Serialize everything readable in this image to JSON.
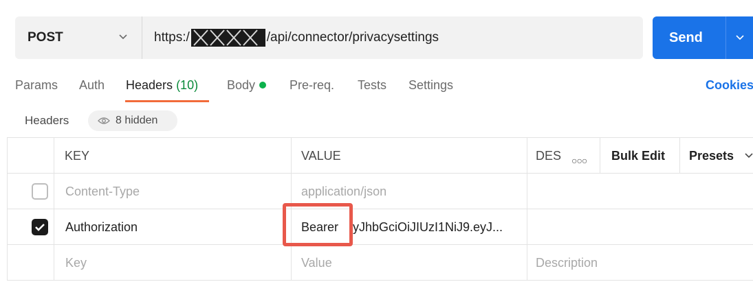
{
  "request": {
    "method": "POST",
    "url_prefix": "https:/",
    "url_suffix": "/api/connector/privacysettings",
    "send_label": "Send"
  },
  "tabs": [
    {
      "label": "Params"
    },
    {
      "label": "Auth"
    },
    {
      "label": "Headers",
      "count": "(10)"
    },
    {
      "label": "Body"
    },
    {
      "label": "Pre-req."
    },
    {
      "label": "Tests"
    },
    {
      "label": "Settings"
    }
  ],
  "cookies_label": "Cookies",
  "headers_section": {
    "title": "Headers",
    "hidden_label": "8 hidden"
  },
  "table": {
    "columns": {
      "key": "KEY",
      "value": "VALUE",
      "description": "DES"
    },
    "bulk_edit": "Bulk Edit",
    "presets": "Presets",
    "rows": [
      {
        "checked": false,
        "key": "Content-Type",
        "value": "application/json",
        "description": ""
      },
      {
        "checked": true,
        "key": "Authorization",
        "value_prefix": "Bearer",
        "value": "yJhbGciOiJIUzI1NiJ9.eyJ...",
        "description": ""
      }
    ],
    "placeholder": {
      "key": "Key",
      "value": "Value",
      "description": "Description"
    }
  },
  "colors": {
    "send": "#1a73e8",
    "active_tab_underline": "#f26b3a",
    "headers_count": "#0a8a3a",
    "body_dot": "#0cb14b",
    "highlight_box": "#e8584b"
  }
}
